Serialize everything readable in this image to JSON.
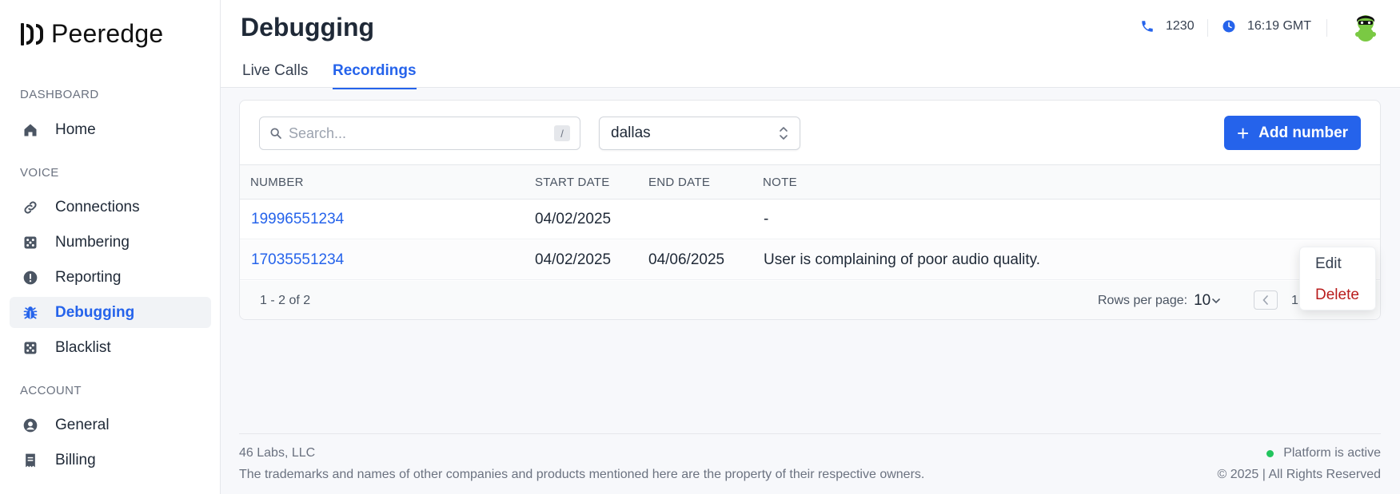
{
  "brand": {
    "name": "Peeredge"
  },
  "sidebar": {
    "sections": [
      {
        "label": "DASHBOARD"
      },
      {
        "label": "VOICE"
      },
      {
        "label": "ACCOUNT"
      }
    ],
    "items": [
      {
        "label": "Home",
        "icon": "home-icon"
      },
      {
        "label": "Connections",
        "icon": "link-icon"
      },
      {
        "label": "Numbering",
        "icon": "dice-icon"
      },
      {
        "label": "Reporting",
        "icon": "alert-circle-icon"
      },
      {
        "label": "Debugging",
        "icon": "bug-icon",
        "active": true
      },
      {
        "label": "Blacklist",
        "icon": "dice-icon"
      },
      {
        "label": "General",
        "icon": "user-circle-icon"
      },
      {
        "label": "Billing",
        "icon": "receipt-icon"
      }
    ]
  },
  "header": {
    "title": "Debugging",
    "tabs": [
      {
        "label": "Live Calls"
      },
      {
        "label": "Recordings",
        "active": true
      }
    ],
    "calls_count": "1230",
    "time": "16:19 GMT"
  },
  "toolbar": {
    "search_placeholder": "Search...",
    "search_shortcut": "/",
    "location_value": "dallas",
    "add_label": "Add number"
  },
  "table": {
    "columns": [
      "NUMBER",
      "START DATE",
      "END DATE",
      "NOTE"
    ],
    "rows": [
      {
        "number": "19996551234",
        "start": "04/02/2025",
        "end": "",
        "note": "-"
      },
      {
        "number": "17035551234",
        "start": "04/02/2025",
        "end": "04/06/2025",
        "note": "User is complaining of poor audio quality."
      }
    ],
    "range": "1 - 2 of 2",
    "rows_per_page_label": "Rows per page:",
    "rows_per_page": "10",
    "page": "1"
  },
  "menu": {
    "edit": "Edit",
    "delete": "Delete"
  },
  "footer": {
    "company": "46 Labs, LLC",
    "legal": "The trademarks and names of other companies and products mentioned here are the property of their respective owners.",
    "status": "Platform is active",
    "copyright": "© 2025 | All Rights Reserved"
  },
  "colors": {
    "accent": "#2563eb",
    "danger": "#b91c1c",
    "success": "#22c55e"
  }
}
